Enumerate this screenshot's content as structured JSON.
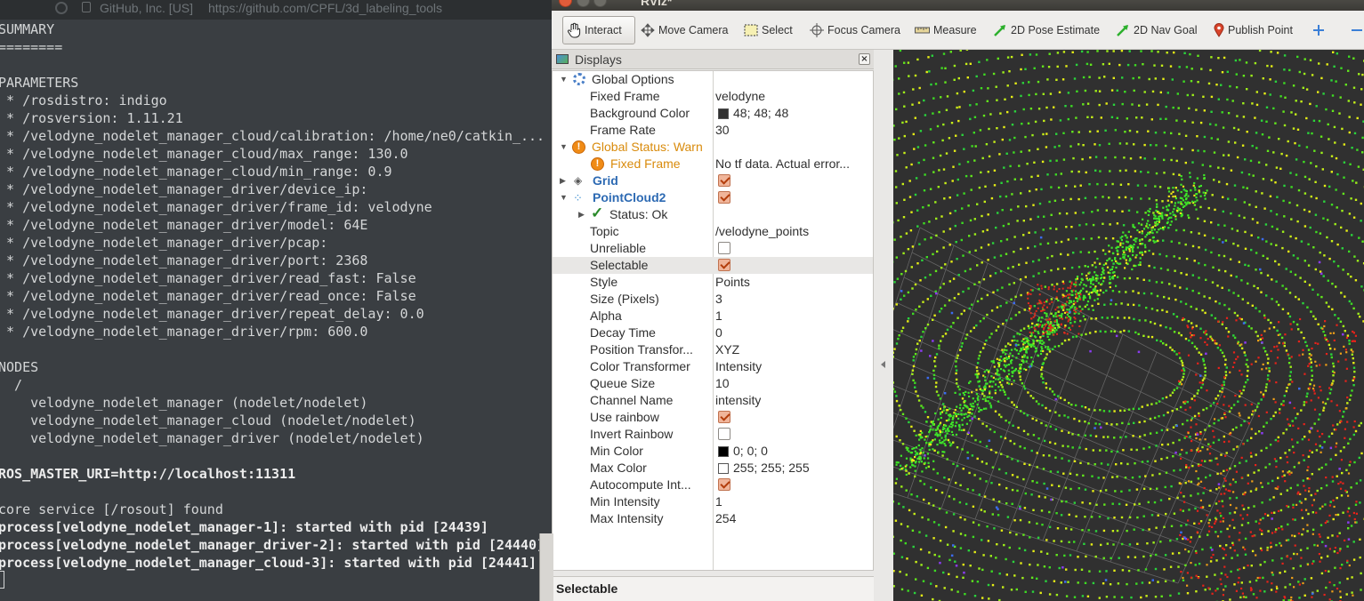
{
  "browser": {
    "org": "GitHub, Inc. [US]",
    "url": "https://github.com/CPFL/3d_labeling_tools"
  },
  "terminal": {
    "lines": [
      "SUMMARY",
      "========",
      "",
      "PARAMETERS",
      " * /rosdistro: indigo",
      " * /rosversion: 1.11.21",
      " * /velodyne_nodelet_manager_cloud/calibration: /home/ne0/catkin_...",
      " * /velodyne_nodelet_manager_cloud/max_range: 130.0",
      " * /velodyne_nodelet_manager_cloud/min_range: 0.9",
      " * /velodyne_nodelet_manager_driver/device_ip:",
      " * /velodyne_nodelet_manager_driver/frame_id: velodyne",
      " * /velodyne_nodelet_manager_driver/model: 64E",
      " * /velodyne_nodelet_manager_driver/pcap:",
      " * /velodyne_nodelet_manager_driver/port: 2368",
      " * /velodyne_nodelet_manager_driver/read_fast: False",
      " * /velodyne_nodelet_manager_driver/read_once: False",
      " * /velodyne_nodelet_manager_driver/repeat_delay: 0.0",
      " * /velodyne_nodelet_manager_driver/rpm: 600.0",
      "",
      "NODES",
      "  /",
      "    velodyne_nodelet_manager (nodelet/nodelet)",
      "    velodyne_nodelet_manager_cloud (nodelet/nodelet)",
      "    velodyne_nodelet_manager_driver (nodelet/nodelet)",
      "",
      "ROS_MASTER_URI=http://localhost:11311",
      "",
      "core service [/rosout] found",
      "process[velodyne_nodelet_manager-1]: started with pid [24439]",
      "process[velodyne_nodelet_manager_driver-2]: started with pid [24440]",
      "process[velodyne_nodelet_manager_cloud-3]: started with pid [24441]"
    ]
  },
  "window": {
    "title": "RViz*"
  },
  "toolbar": {
    "interact": "Interact",
    "move_camera": "Move Camera",
    "select": "Select",
    "focus_camera": "Focus Camera",
    "measure": "Measure",
    "pose_estimate": "2D Pose Estimate",
    "nav_goal": "2D Nav Goal",
    "publish_point": "Publish Point"
  },
  "displays": {
    "title": "Displays",
    "close": "×",
    "global_options": "Global Options",
    "fixed_frame_k": "Fixed Frame",
    "fixed_frame_v": "velodyne",
    "bg_color_k": "Background Color",
    "bg_color_v": "48; 48; 48",
    "frame_rate_k": "Frame Rate",
    "frame_rate_v": "30",
    "global_status": "Global Status: Warn",
    "ff_warn_k": "Fixed Frame",
    "ff_warn_v": "No tf data.  Actual error...",
    "grid": "Grid",
    "pointcloud": "PointCloud2",
    "status_ok": "Status: Ok",
    "topic_k": "Topic",
    "topic_v": "/velodyne_points",
    "unreliable_k": "Unreliable",
    "selectable_k": "Selectable",
    "style_k": "Style",
    "style_v": "Points",
    "size_k": "Size (Pixels)",
    "size_v": "3",
    "alpha_k": "Alpha",
    "alpha_v": "1",
    "decay_k": "Decay Time",
    "decay_v": "0",
    "pos_tf_k": "Position Transfor...",
    "pos_tf_v": "XYZ",
    "color_tf_k": "Color Transformer",
    "color_tf_v": "Intensity",
    "queue_k": "Queue Size",
    "queue_v": "10",
    "channel_k": "Channel Name",
    "channel_v": "intensity",
    "rainbow_k": "Use rainbow",
    "invert_k": "Invert Rainbow",
    "min_color_k": "Min Color",
    "min_color_v": "0; 0; 0",
    "max_color_k": "Max Color",
    "max_color_v": "255; 255; 255",
    "autocompute_k": "Autocompute Int...",
    "min_int_k": "Min Intensity",
    "min_int_v": "1",
    "max_int_k": "Max Intensity",
    "max_int_v": "254"
  },
  "description": {
    "title": "Selectable"
  },
  "colors": {
    "bg": "#303030",
    "warn": "#f08b16",
    "accent": "#2d6ab3"
  }
}
